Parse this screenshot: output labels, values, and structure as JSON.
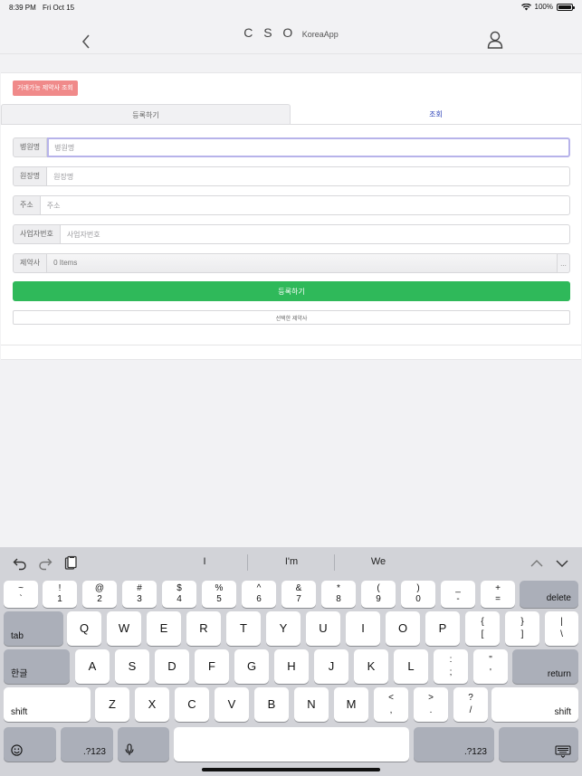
{
  "status_bar": {
    "time": "8:39 PM",
    "date": "Fri Oct 15",
    "battery": "100%"
  },
  "nav": {
    "title": "C S O",
    "subtitle": "KoreaApp",
    "back_icon": "chevron-left-icon",
    "user_icon": "user-icon"
  },
  "panel": {
    "top_button": "거래가능 제약사 조회",
    "tabs": [
      {
        "label": "등록하기"
      },
      {
        "label": "조회"
      }
    ],
    "fields": [
      {
        "label": "병원명",
        "placeholder": "병원명",
        "value": ""
      },
      {
        "label": "원장명",
        "placeholder": "원장명",
        "value": ""
      },
      {
        "label": "주소",
        "placeholder": "주소",
        "value": ""
      },
      {
        "label": "사업자번호",
        "placeholder": "사업자번호",
        "value": ""
      }
    ],
    "pharma": {
      "label": "제약사",
      "value": "0 Items",
      "more": "..."
    },
    "submit_button": "등록하기",
    "selected_button": "선택한 제약사"
  },
  "keyboard": {
    "suggestions": [
      "I",
      "I'm",
      "We"
    ],
    "row1": [
      {
        "top": "~",
        "bottom": "`"
      },
      {
        "top": "!",
        "bottom": "1"
      },
      {
        "top": "@",
        "bottom": "2"
      },
      {
        "top": "#",
        "bottom": "3"
      },
      {
        "top": "$",
        "bottom": "4"
      },
      {
        "top": "%",
        "bottom": "5"
      },
      {
        "top": "^",
        "bottom": "6"
      },
      {
        "top": "&",
        "bottom": "7"
      },
      {
        "top": "*",
        "bottom": "8"
      },
      {
        "top": "(",
        "bottom": "9"
      },
      {
        "top": ")",
        "bottom": "0"
      },
      {
        "top": "_",
        "bottom": "-"
      },
      {
        "top": "+",
        "bottom": "="
      }
    ],
    "delete": "delete",
    "tab": "tab",
    "row2": [
      "Q",
      "W",
      "E",
      "R",
      "T",
      "Y",
      "U",
      "I",
      "O",
      "P"
    ],
    "row2_extra": [
      {
        "top": "{",
        "bottom": "["
      },
      {
        "top": "}",
        "bottom": "]"
      },
      {
        "top": "|",
        "bottom": "\\"
      }
    ],
    "hangul": "한글",
    "row3": [
      "A",
      "S",
      "D",
      "F",
      "G",
      "H",
      "J",
      "K",
      "L"
    ],
    "row3_extra": [
      {
        "top": ":",
        "bottom": ";"
      },
      {
        "top": "\"",
        "bottom": "'"
      }
    ],
    "return": "return",
    "shift": "shift",
    "row4": [
      "Z",
      "X",
      "C",
      "V",
      "B",
      "N",
      "M"
    ],
    "row4_extra": [
      {
        "top": "<",
        "bottom": ","
      },
      {
        "top": ">",
        "bottom": "."
      },
      {
        "top": "?",
        "bottom": "/"
      }
    ],
    "num_key": ".?123"
  }
}
